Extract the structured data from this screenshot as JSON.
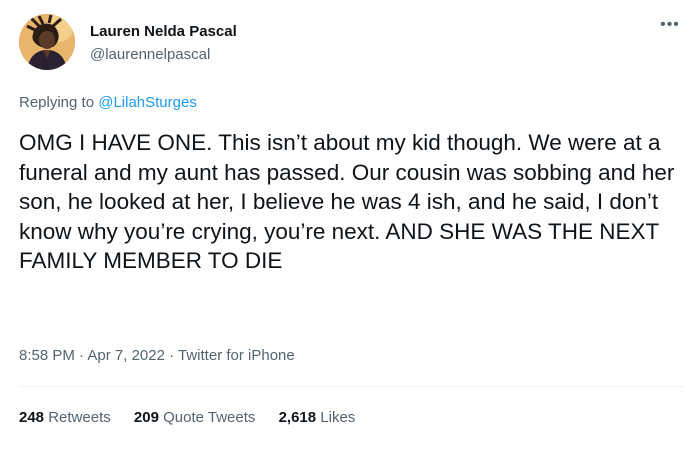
{
  "author": {
    "display_name": "Lauren Nelda Pascal",
    "handle": "@laurennelpascal",
    "avatar": "profile-photo"
  },
  "more_icon": "more-horizontal-icon",
  "reply": {
    "prefix": "Replying to ",
    "mention": "@LilahSturges"
  },
  "tweet": {
    "text": "OMG I HAVE ONE. This isn’t about my kid though. We were at a funeral and my aunt has passed. Our cousin was sobbing and her son, he looked at her, I believe he was 4 ish, and he said, I don’t know why you’re crying, you’re next. AND SHE WAS THE NEXT FAMILY MEMBER TO DIE",
    "time": "8:58 PM",
    "separator": " · ",
    "date": "Apr 7, 2022",
    "source": "Twitter for iPhone"
  },
  "stats": {
    "retweets_count": "248",
    "retweets_label": "Retweets",
    "quotes_count": "209",
    "quotes_label": "Quote Tweets",
    "likes_count": "2,618",
    "likes_label": "Likes"
  },
  "colors": {
    "text": "#0f1419",
    "secondary": "#536471",
    "accent": "#1d9bf0",
    "divider": "#eff3f4"
  }
}
